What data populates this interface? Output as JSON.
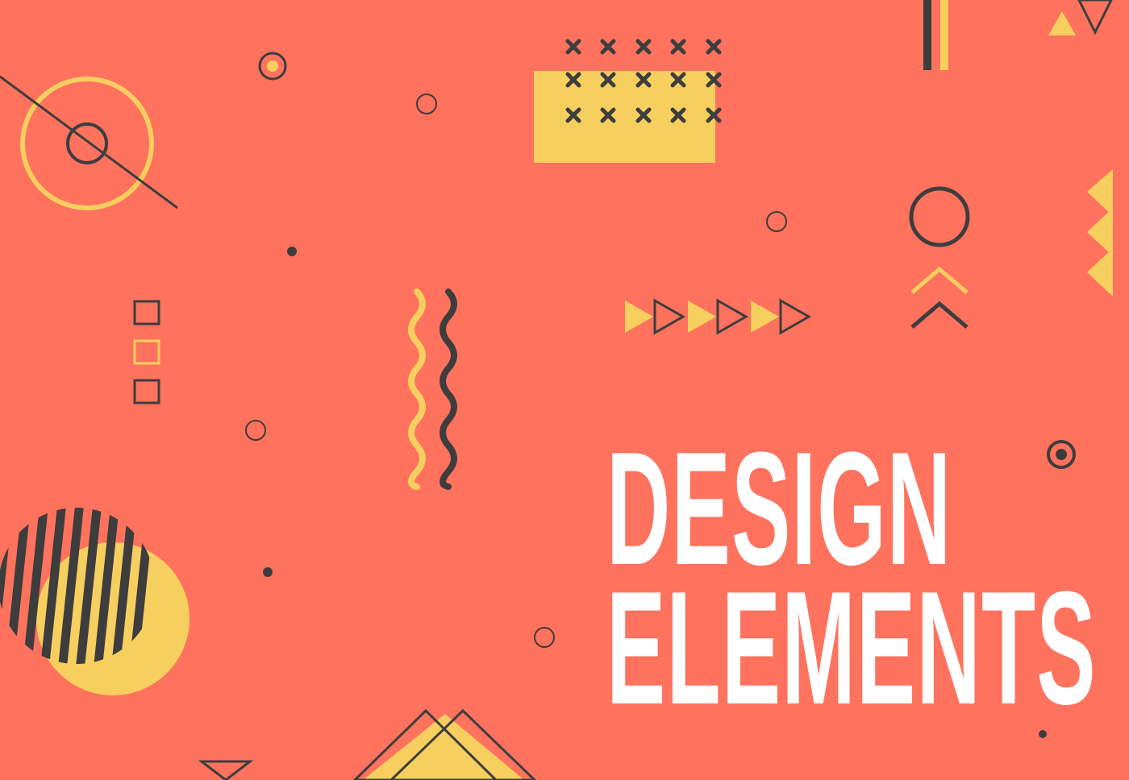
{
  "title": {
    "line1": "DESIGN",
    "line2": "ELEMENTS"
  },
  "colors": {
    "background": "#ff725e",
    "accent_yellow": "#f6cf5f",
    "dark": "#3d3d3d",
    "text": "#ffffff"
  },
  "shapes": [
    "concentric-circle-crosshair",
    "x-mark-grid-on-yellow-rectangle",
    "double-vertical-bars",
    "outline-triangles",
    "target-ring",
    "outline-circle",
    "chevron-pair",
    "zigzag-triangles",
    "triangle-row",
    "wavy-lines",
    "square-stack",
    "striped-circle-with-yellow-circle",
    "overlapping-diamonds",
    "small-dots",
    "small-rings"
  ]
}
